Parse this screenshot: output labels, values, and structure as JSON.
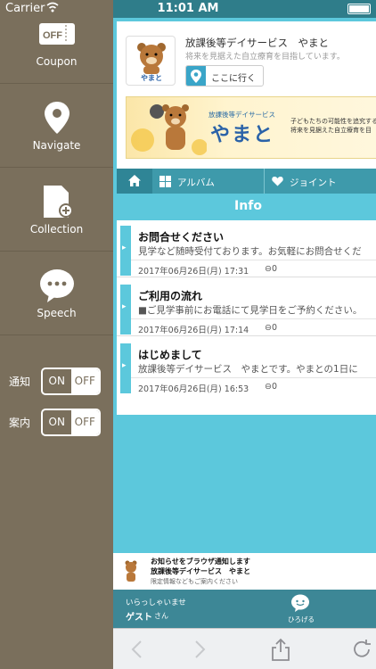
{
  "status": {
    "carrier": "Carrier",
    "time": "11:01 AM"
  },
  "sidemenu": {
    "items": [
      {
        "label": "Coupon",
        "icon": "coupon-icon"
      },
      {
        "label": "Navigate",
        "icon": "map-pin-icon"
      },
      {
        "label": "Collection",
        "icon": "collection-icon"
      },
      {
        "label": "Speech",
        "icon": "speech-bubble-icon"
      }
    ],
    "toggles": [
      {
        "label": "通知",
        "on": "ON",
        "off": "OFF",
        "selected": "OFF"
      },
      {
        "label": "案内",
        "on": "ON",
        "off": "OFF",
        "selected": "OFF"
      }
    ]
  },
  "shop": {
    "name": "放課後等デイサービス　やまと",
    "tagline": "将来を見据えた自立療育を目指しています。",
    "logo_text": "やまと",
    "goto_label": "ここに行く",
    "banner": {
      "small": "放課後等デイサービス",
      "big": "やまと",
      "right1": "子どもたちの可能性を追究する",
      "right2": "将来を見据えた自立療育を目"
    }
  },
  "tabs": {
    "album": "アルバム",
    "joint": "ジョイント"
  },
  "info_title": "Info",
  "news": [
    {
      "title": "お問合せください",
      "body": "見学など随時受付ております。お気軽にお問合せくだ",
      "date": "2017年06月26日(月) 17:31",
      "comments": "0"
    },
    {
      "title": "ご利用の流れ",
      "body": "■ご見学事前にお電話にて見学日をご予約ください。",
      "date": "2017年06月26日(月) 17:14",
      "comments": "0"
    },
    {
      "title": "はじめまして",
      "body": "放課後等デイサービス　やまとです。やまとの1日に",
      "date": "2017年06月26日(月) 16:53",
      "comments": "0"
    }
  ],
  "notice": {
    "line1": "お知らせをブラウザ通知します",
    "line2": "放課後等デイサービス　やまと",
    "line3": "限定情報などもご案内ください"
  },
  "guest": {
    "greeting": "いらっしゃいませ",
    "name": "ゲスト",
    "suffix": "さん",
    "open_label": "ひろげる"
  },
  "colors": {
    "sidebar": "#7a6f5c",
    "accent": "#5cc8dc",
    "dark_teal": "#3d8796"
  }
}
